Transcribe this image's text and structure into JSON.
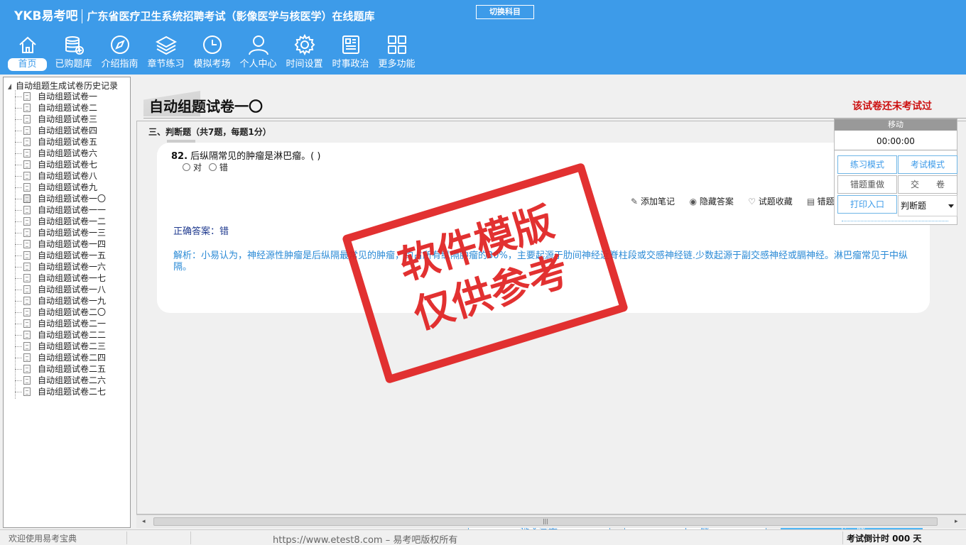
{
  "app": {
    "logo": "YKB易考吧",
    "title": "广东省医疗卫生系统招聘考试（影像医学与核医学）在线题库",
    "switch_subject": "切换科目"
  },
  "nav": [
    {
      "label": "首页",
      "icon": "home-icon",
      "active": true
    },
    {
      "label": "已购题库",
      "icon": "database-icon"
    },
    {
      "label": "介绍指南",
      "icon": "compass-icon"
    },
    {
      "label": "章节练习",
      "icon": "layers-icon"
    },
    {
      "label": "模拟考场",
      "icon": "clock-icon"
    },
    {
      "label": "个人中心",
      "icon": "user-icon"
    },
    {
      "label": "时间设置",
      "icon": "gear-icon"
    },
    {
      "label": "时事政治",
      "icon": "newspaper-icon"
    },
    {
      "label": "更多功能",
      "icon": "grid-icon"
    }
  ],
  "tree": {
    "root": "自动组题生成试卷历史记录",
    "items": [
      "自动组题试卷一",
      "自动组题试卷二",
      "自动组题试卷三",
      "自动组题试卷四",
      "自动组题试卷五",
      "自动组题试卷六",
      "自动组题试卷七",
      "自动组题试卷八",
      "自动组题试卷九",
      "自动组题试卷一〇",
      "自动组题试卷一一",
      "自动组题试卷一二",
      "自动组题试卷一三",
      "自动组题试卷一四",
      "自动组题试卷一五",
      "自动组题试卷一六",
      "自动组题试卷一七",
      "自动组题试卷一八",
      "自动组题试卷一九",
      "自动组题试卷二〇",
      "自动组题试卷二一",
      "自动组题试卷二二",
      "自动组题试卷二三",
      "自动组题试卷二四",
      "自动组题试卷二五",
      "自动组题试卷二六",
      "自动组题试卷二七"
    ],
    "current_index": 9
  },
  "paper": {
    "title": "自动组题试卷一〇",
    "status": "该试卷还未考试过",
    "section": "三、判断题（共7题，每题1分）"
  },
  "question": {
    "number": "82.",
    "text": "后纵隔常见的肿瘤是淋巴瘤。( )",
    "options": [
      "对",
      "错"
    ],
    "tools": {
      "note": "添加笔记",
      "hide_answer": "隐藏答案",
      "favorite": "试题收藏",
      "error": "错题"
    },
    "answer": "正确答案：错",
    "analysis": "解析：小易认为，神经源性肿瘤是后纵隔最常见的肿瘤，约占所有纵隔肿瘤的30%，主要起源于肋间神经近脊柱段或交感神经链.少数起源于副交感神经或膈神经。淋巴瘤常见于中纵隔。"
  },
  "buttons": {
    "submit": "提交答案",
    "prev": "上一题",
    "next": "下一题"
  },
  "panel": {
    "move": "移动",
    "timer": "00:00:00",
    "practice_mode": "练习模式",
    "exam_mode": "考试模式",
    "redo_errors": "错题重做",
    "submit_paper": "交　　卷",
    "print": "打印入口",
    "type_select": "判断题"
  },
  "watermark": {
    "line1": "软件模版",
    "line2": "仅供参考"
  },
  "statusbar": {
    "welcome": "欢迎使用易考宝典",
    "copyright": "https://www.etest8.com – 易考吧版权所有",
    "countdown": "考试倒计时 000 天"
  },
  "colors": {
    "brand": "#3d9be9",
    "status_red": "#cc1111",
    "answer_blue": "#1f3a8f",
    "analysis_blue": "#2a8ad6",
    "stamp_red": "#e02020"
  }
}
